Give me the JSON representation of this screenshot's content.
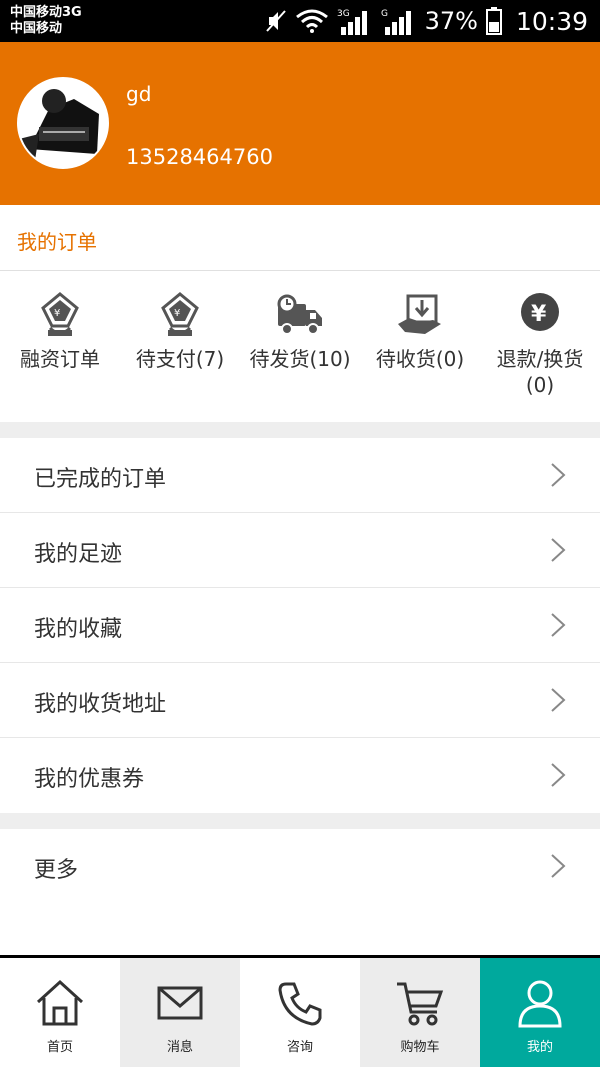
{
  "status_bar": {
    "carrier_line1": "中国移动3G",
    "carrier_line2": "中国移动",
    "network_3g": "3G",
    "network_g": "G",
    "battery": "37%",
    "time": "10:39"
  },
  "profile": {
    "username": "gd",
    "phone": "13528464760"
  },
  "orders": {
    "title": "我的订单",
    "statuses": [
      {
        "label": "融资订单",
        "icon": "finance-order-icon"
      },
      {
        "label": "待支付(7)",
        "icon": "pending-payment-icon"
      },
      {
        "label": "待发货(10)",
        "icon": "pending-shipment-icon"
      },
      {
        "label": "待收货(0)",
        "icon": "pending-receipt-icon"
      },
      {
        "label": "退款/换货(0)",
        "icon": "refund-icon"
      }
    ]
  },
  "menu": {
    "items": [
      {
        "label": "已完成的订单"
      },
      {
        "label": "我的足迹"
      },
      {
        "label": "我的收藏"
      },
      {
        "label": "我的收货地址"
      },
      {
        "label": "我的优惠券"
      }
    ],
    "more": {
      "label": "更多"
    }
  },
  "tabbar": {
    "tabs": [
      {
        "label": "首页",
        "icon": "home-icon"
      },
      {
        "label": "消息",
        "icon": "mail-icon"
      },
      {
        "label": "咨询",
        "icon": "phone-icon"
      },
      {
        "label": "购物车",
        "icon": "cart-icon"
      },
      {
        "label": "我的",
        "icon": "user-icon"
      }
    ],
    "active": "我的"
  },
  "colors": {
    "accent": "#e67200",
    "active_tab": "#00a99d"
  }
}
